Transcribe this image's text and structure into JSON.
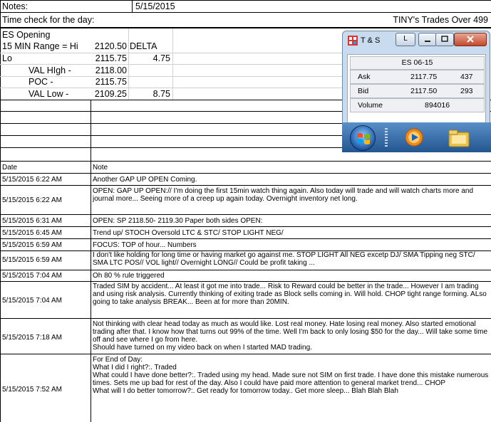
{
  "header": {
    "notes_label": "Notes:",
    "notes_date": "5/15/2015",
    "time_check_label": "Time check for the day:",
    "trades_title": "TINY's Trades Over 499"
  },
  "levels": {
    "es_opening": "ES Opening",
    "range_label": "15 MIN Range = Hi",
    "hi_value": "2120.50",
    "delta_label": "DELTA",
    "lo_label": "Lo",
    "lo_value": "2115.75",
    "lo_delta": "4.75",
    "val_high_label": "VAL HIgh   -",
    "val_high_value": "2118.00",
    "poc_label": "POC   -",
    "poc_value": "2115.75",
    "val_low_label": "VAL Low   -",
    "val_low_value": "2109.25",
    "val_low_delta": "8.75"
  },
  "ts_window": {
    "title": "T & S",
    "l_button": "L",
    "symbol": "ES 06-15",
    "ask_label": "Ask",
    "ask_price": "2117.75",
    "ask_size": "437",
    "bid_label": "Bid",
    "bid_price": "2117.50",
    "bid_size": "293",
    "volume_label": "Volume",
    "volume_value": "894016"
  },
  "log": {
    "date_header": "Date",
    "note_header": "Note",
    "rows": [
      {
        "date": "5/15/2015 6:22 AM",
        "note": "Another GAP UP OPEN Coming."
      },
      {
        "date": "5/15/2015 6:22 AM",
        "note": "OPEN: GAP UP OPEN://  I'm doing the first 15min watch thing again.  Also today will trade and will watch charts more and journal more... Seeing more of a creep up again today.  Overnight inventory net long."
      },
      {
        "date": "5/15/2015 6:31 AM",
        "note": "OPEN: SP 2118.50- 2119.30 Paper both sides OPEN:"
      },
      {
        "date": "5/15/2015 6:45 AM",
        "note": "Trend up/ STOCH Oversold LTC & STC/ STOP LIGHT NEG/"
      },
      {
        "date": "5/15/2015 6:59 AM",
        "note": "FOCUS: TOP of hour... Numbers"
      },
      {
        "date": "5/15/2015 6:59 AM",
        "note": "I don't like holding for long time or having market go against me.  STOP LIGHT All NEG excetp DJ/ SMA Tipping neg STC/ SMA LTC POS// VOL light// Overnight LONG// Could be profit taking ..."
      },
      {
        "date": "5/15/2015 7:04 AM",
        "note": "Oh 80 % rule triggered"
      },
      {
        "date": "5/15/2015 7:04 AM",
        "note": "Traded SIM by accident... At least it got me into trade... Risk to Reward could be better in the trade... However I am trading and using risk analysis.  Currently thinking of exiting trade as Block sells coming in.  Will hold.  CHOP tight range forming.  ALso going to take analysis BREAK... Been  at for more than 20MIN."
      },
      {
        "date": "5/15/2015 7:18 AM",
        "note": "Not thinking with clear head today as much as would like.  Lost real money.  Hate losing real money.  Also started emotional trading after that.  I know how that turns out 99% of the time.  Well I'm back to only losing $50 for the day... Will take some time off and see where I go from here.\nShould have turned on my video back on when I started MAD trading."
      },
      {
        "date": "5/15/2015 7:52 AM",
        "note": "For End of Day:\nWhat I did I right?:.  Traded\nWhat could I have done better?:.  Traded using my head.  Made sure not SIM on first trade.  I have done this mistake numerous times.  Sets me up bad for rest of the day.  Also I could have paid more attention to general market trend... CHOP\nWhat will I do better tomorrow?:.  Get ready for tomorrow today.. Get more sleep... Blah Blah Blah"
      }
    ]
  }
}
